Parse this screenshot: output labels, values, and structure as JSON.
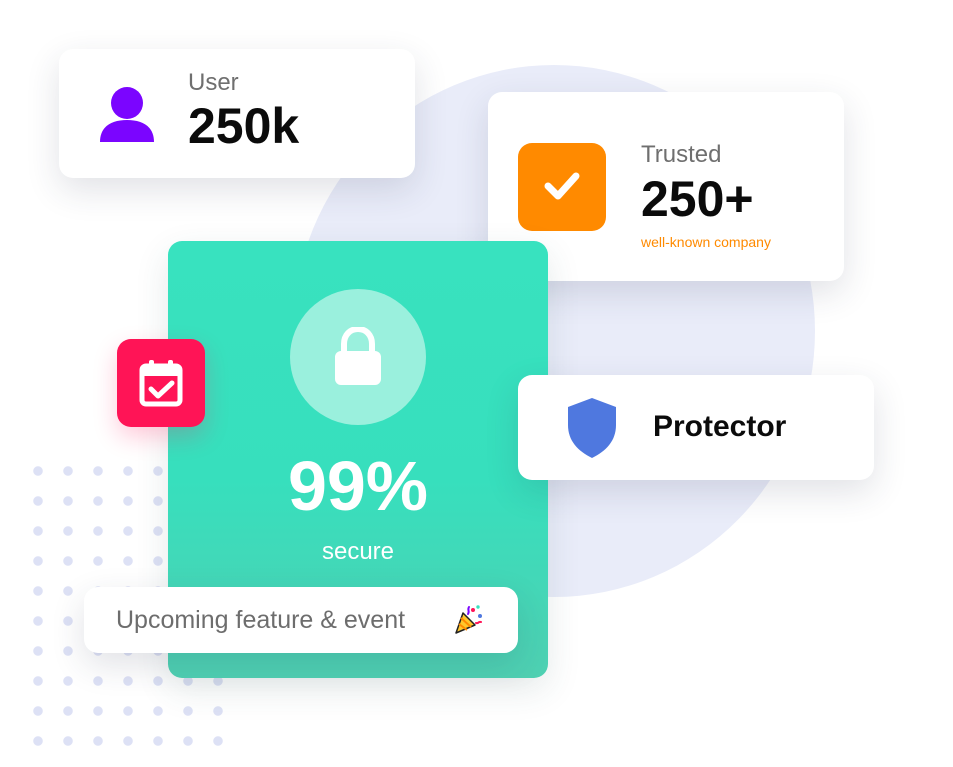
{
  "user_stat": {
    "label": "User",
    "value": "250k"
  },
  "trusted_stat": {
    "label": "Trusted",
    "value": "250+",
    "subtitle": "well-known company"
  },
  "secure_stat": {
    "value": "99%",
    "label": "secure"
  },
  "protector": {
    "label": "Protector"
  },
  "event": {
    "label": "Upcoming feature & event"
  },
  "icons": {
    "user": "user-icon",
    "check": "check-icon",
    "lock": "lock-icon",
    "calendar": "calendar-check-icon",
    "shield": "shield-icon",
    "party": "party-popper-icon"
  },
  "colors": {
    "user_icon": "#7b05ff",
    "check_tile": "#ff8a00",
    "trusted_subtitle": "#ff8a00",
    "secure_card": "#38e2bf",
    "lock_circle": "#9af0dd",
    "calendar_tile": "#ff1456",
    "shield": "#4f78df",
    "background_circle": "#e9ecf9",
    "dots": "#dde1f5"
  }
}
